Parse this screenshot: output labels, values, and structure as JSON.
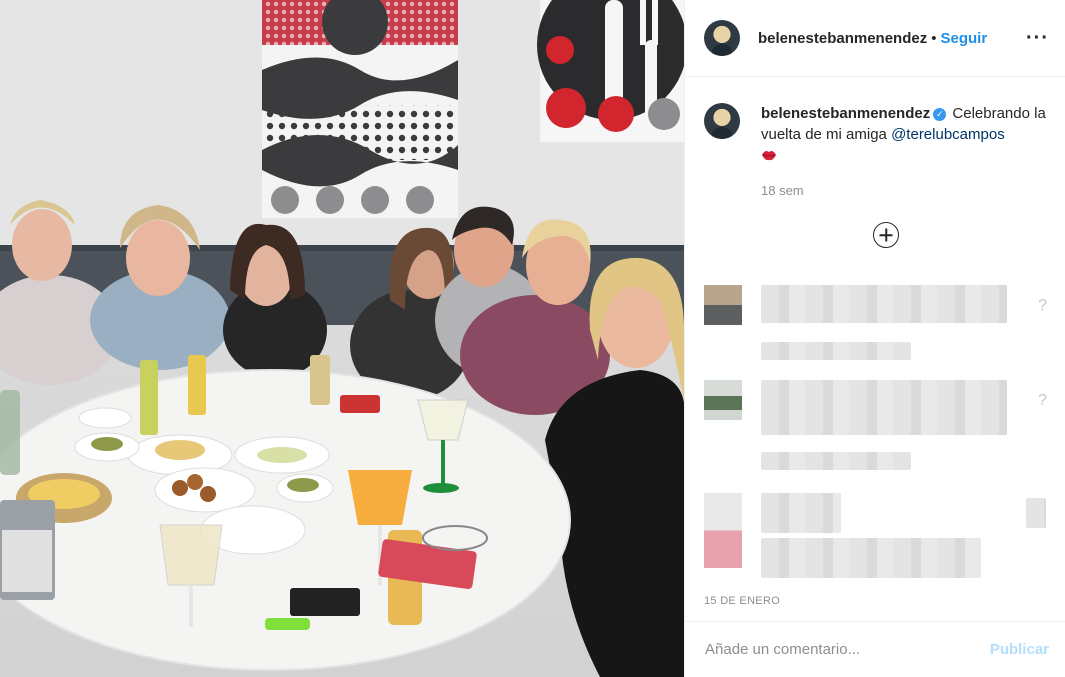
{
  "post": {
    "username": "belenestebanmenendez",
    "separator": "•",
    "follow_label": "Seguir",
    "more_icon": "more-horizontal-icon",
    "caption_text": "Celebrando la vuelta de mi amiga",
    "caption_mention": "@terelubcampos",
    "caption_emoji": "lips-icon",
    "caption_time": "18 sem",
    "load_more_icon": "plus-circle-icon",
    "date": "15 DE ENERO",
    "comment_placeholder": "Añade un comentario...",
    "publish_label": "Publicar"
  },
  "colors": {
    "link_blue": "#1f8fe8",
    "verified_blue": "#3897f0",
    "mention_blue": "#003569",
    "muted_gray": "#8e8e8e",
    "publish_disabled": "#b2dffc"
  }
}
